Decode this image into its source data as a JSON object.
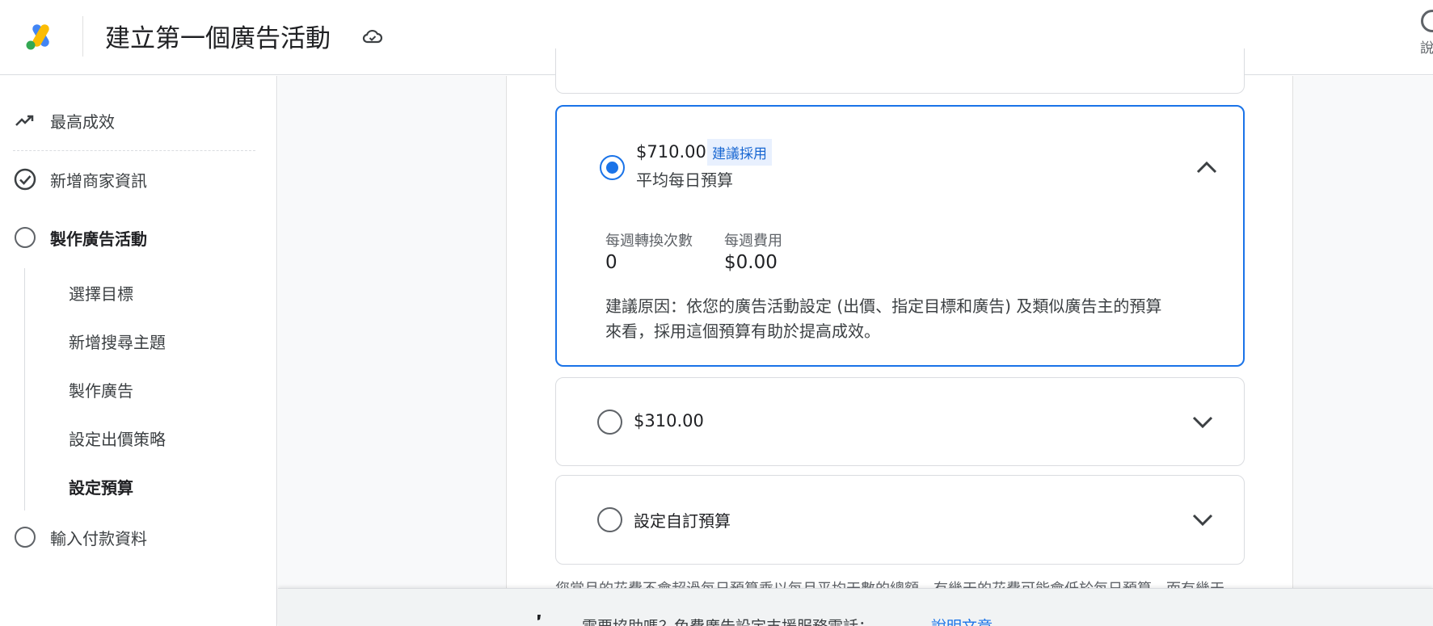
{
  "header": {
    "title": "建立第一個廣告活動",
    "help_label": "說"
  },
  "sidebar": {
    "top_item": "最高成效",
    "steps": [
      {
        "label": "新增商家資訊",
        "status": "completed"
      },
      {
        "label": "製作廣告活動",
        "status": "current"
      },
      {
        "label": "輸入付款資料",
        "status": "pending"
      }
    ],
    "substeps": [
      "選擇目標",
      "新增搜尋主題",
      "製作廣告",
      "設定出價策略",
      "設定預算"
    ],
    "active_substep": "設定預算"
  },
  "budget_options": {
    "selected": {
      "amount": "$710.00",
      "badge": "建議採用",
      "subtitle": "平均每日預算",
      "stat1_label": "每週轉換次數",
      "stat1_value": "0",
      "stat2_label": "每週費用",
      "stat2_value": "$0.00",
      "reason_line1": "建議原因：依您的廣告活動設定 (出價、指定目標和廣告) 及類似廣告主的預算",
      "reason_line2": "來看，採用這個預算有助於提高成效。"
    },
    "option2": {
      "amount": "$310.00"
    },
    "option3": {
      "label": "設定自訂預算"
    }
  },
  "footnote": "您當月的花費不會超過每日預算乘以每月平均天數的總額，有幾天的花費可能會低於每日預算，而有幾天",
  "help_bar": {
    "message": "需要協助嗎？免費廣告設定支援服務電話：",
    "link": "說明文章"
  },
  "colors": {
    "accent": "#1a73e8",
    "badge_bg": "#e8f0fe"
  }
}
